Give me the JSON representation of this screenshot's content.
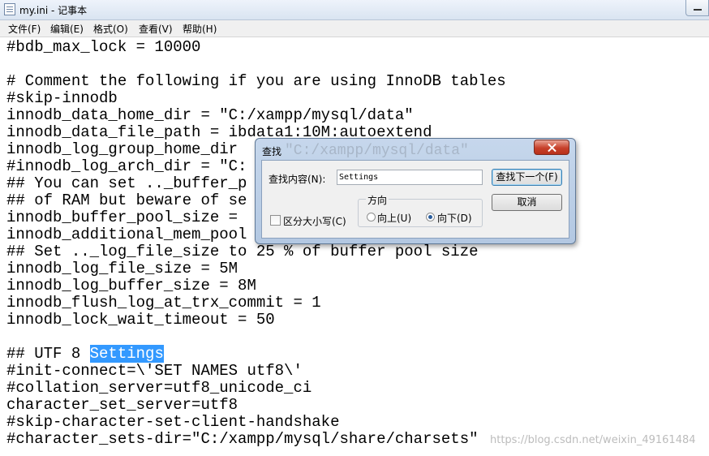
{
  "window": {
    "title": "my.ini - 记事本"
  },
  "menu": [
    "文件(F)",
    "编辑(E)",
    "格式(O)",
    "查看(V)",
    "帮助(H)"
  ],
  "editor": {
    "lines": [
      "#bdb_max_lock = 10000",
      "",
      "# Comment the following if you are using InnoDB tables",
      "#skip-innodb",
      "innodb_data_home_dir = \"C:/xampp/mysql/data\"",
      "innodb_data_file_path = ibdata1:10M:autoextend",
      "innodb_log_group_home_dir",
      "#innodb_log_arch_dir = \"C:",
      "## You can set .._buffer_p",
      "## of RAM but beware of se",
      "innodb_buffer_pool_size =",
      "innodb_additional_mem_pool",
      "## Set .._log_file_size to 25 % of buffer pool size",
      "innodb_log_file_size = 5M",
      "innodb_log_buffer_size = 8M",
      "innodb_flush_log_at_trx_commit = 1",
      "innodb_lock_wait_timeout = 50",
      "",
      "#init-connect=\\'SET NAMES utf8\\'",
      "#collation_server=utf8_unicode_ci",
      "character_set_server=utf8",
      "#skip-character-set-client-handshake",
      "#character_sets-dir=\"C:/xampp/mysql/share/charsets\""
    ],
    "highlight_line": {
      "prefix": "## UTF 8 ",
      "selected": "Settings"
    }
  },
  "watermark": "https://blog.csdn.net/weixin_49161484",
  "find_dialog": {
    "title": "查找",
    "ghost_text": "\"C:/xampp/mysql/data\"",
    "find_label": "查找内容(N):",
    "find_value": "Settings",
    "find_next": "查找下一个(F)",
    "cancel": "取消",
    "match_case": "区分大小写(C)",
    "direction_label": "方向",
    "up": "向上(U)",
    "down": "向下(D)",
    "direction_selected": "down",
    "match_case_checked": false
  }
}
